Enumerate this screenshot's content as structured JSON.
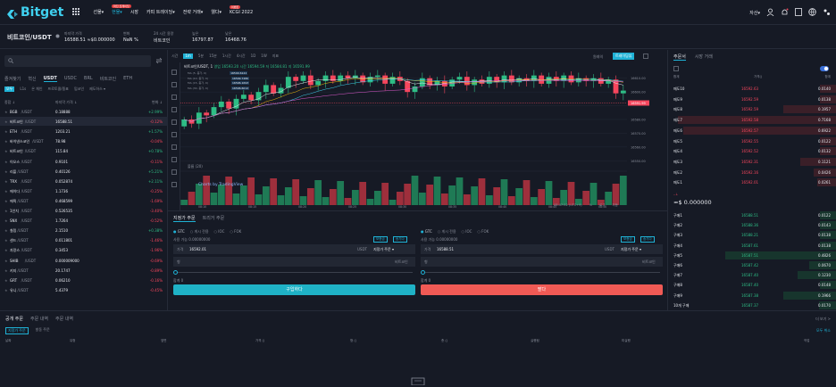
{
  "nav": {
    "logo": "Bitget",
    "items": [
      {
        "label": "선물",
        "caret": "▾"
      },
      {
        "label": "현물",
        "caret": "▾",
        "badge": "마진 트레이딩"
      },
      {
        "label": "시장"
      },
      {
        "label": "카피 트레이딩",
        "caret": "▾"
      },
      {
        "label": "전략 거래",
        "caret": "▾"
      },
      {
        "label": "웰다",
        "caret": "▾"
      },
      {
        "label": "KCGI 2022",
        "badge": "이벤트"
      }
    ],
    "assets_label": "자산",
    "assets_caret": "▾"
  },
  "ticker": {
    "pair": "비트코인/USDT",
    "price_label": "마지막 가격",
    "price": "16588.51 ≈$0.000000",
    "change_label": "변화",
    "change": "NaN %",
    "high_label": "24 시간 용량",
    "high": "비트코인",
    "low_label": "높은",
    "low": "16797.87",
    "vol_label": "낮은",
    "vol": "16468.76"
  },
  "left": {
    "search_placeholder": "",
    "tabs": [
      "즐겨찾기",
      "혁신",
      "USDT",
      "USDC",
      "BRL",
      "비트코인",
      "ETH"
    ],
    "subtabs": [
      "모두",
      "L1s",
      "온 체인",
      "프로토콜/중표",
      "밈코인",
      "제도하스 ▾"
    ],
    "col_pair": "종합 ↓",
    "col_price": "마지막 가격 ↓",
    "col_change": "변화 ↓",
    "rows": [
      {
        "base": "BGB",
        "quote": "/USDT",
        "price": "0.18888",
        "change": "+2.99%",
        "up": true
      },
      {
        "base": "비트코인",
        "quote": "/USDT",
        "price": "16588.51",
        "change": "-0.12%",
        "up": false
      },
      {
        "base": "ETH",
        "quote": "/USDT",
        "price": "1203.21",
        "change": "+1.57%",
        "up": true
      },
      {
        "base": "바이낸스코인",
        "quote": "/USDT",
        "price": "78.98",
        "change": "-0.04%",
        "up": false
      },
      {
        "base": "비트코인",
        "quote": "/USDT",
        "price": "115.84",
        "change": "+0.78%",
        "up": true
      },
      {
        "base": "이오스",
        "quote": "/USDT",
        "price": "0.9101",
        "change": "-0.11%",
        "up": false
      },
      {
        "base": "리플",
        "quote": "/USDT",
        "price": "0.40126",
        "change": "+5.21%",
        "up": true
      },
      {
        "base": "TRX",
        "quote": "/USDT",
        "price": "0.052874",
        "change": "+2.11%",
        "up": true
      },
      {
        "base": "에이다",
        "quote": "/USDT",
        "price": "1.1736",
        "change": "-0.25%",
        "up": false
      },
      {
        "base": "에픽",
        "quote": "/USDT",
        "price": "0.468599",
        "change": "-1.69%",
        "up": false
      },
      {
        "base": "1인치",
        "quote": "/USDT",
        "price": "0.526535",
        "change": "-3.40%",
        "up": false
      },
      {
        "base": "SNX",
        "quote": "/USDT",
        "price": "1.7264",
        "change": "-0.52%",
        "up": false
      },
      {
        "base": "칠링",
        "quote": "/USDT",
        "price": "2.1510",
        "change": "+0.38%",
        "up": true
      },
      {
        "base": "샌드",
        "quote": "/USDT",
        "price": "0.011801",
        "change": "-1.46%",
        "up": false
      },
      {
        "base": "자랑스",
        "quote": "/USDT",
        "price": "0.3453",
        "change": "-1.96%",
        "up": false
      },
      {
        "base": "SHIB",
        "quote": "/USDT",
        "price": "0.000009000",
        "change": "-0.69%",
        "up": false
      },
      {
        "base": "키지",
        "quote": "/USDT",
        "price": "20.1747",
        "change": "-0.89%",
        "up": false
      },
      {
        "base": "GRT",
        "quote": "/USDT",
        "price": "0.06210",
        "change": "-0.16%",
        "up": false
      },
      {
        "base": "유니",
        "quote": "/USDT",
        "price": "5.4379",
        "change": "-0.45%",
        "up": false
      }
    ]
  },
  "chart": {
    "toolbar": [
      "시간",
      "1m",
      "5분",
      "15분",
      "1시간",
      "4시간",
      "1D",
      "1W",
      "지표"
    ],
    "right_tools": [
      "원래의",
      "트레이딩뷰"
    ],
    "title": "비트코인/USDT, 1",
    "open": "영업 16593.20",
    "high": "시간 16594.59",
    "low": "저 16584.81",
    "close": "지 16591.99",
    "ma": [
      {
        "label": "MA (5, 종가, 0)",
        "value": "16590.6122"
      },
      {
        "label": "MA (10, 종가, 0)",
        "value": "16599.7480"
      },
      {
        "label": "MA (15, 종가, 0)",
        "value": "16596.1693"
      },
      {
        "label": "MA (30, 종가, 0)",
        "value": "16596.6012"
      }
    ],
    "volume_label": "볼륨 (20)",
    "watermark": "Charts by TradingView",
    "price_ticks": [
      "16610.00",
      "16600.00",
      "16591.99",
      "16580.00",
      "16570.00",
      "16560.00",
      "16550.00"
    ],
    "current_price": "16591.99",
    "time_ticks": [
      "08:10",
      "08:15",
      "08:20",
      "08:25",
      "08:30",
      "08:35",
      "08:40",
      "08:45",
      "08:50"
    ],
    "footer": [
      "08:47:52 (UTC+9)",
      "%",
      "로그",
      "자동"
    ]
  },
  "order": {
    "tabs": [
      "지정가 주문",
      "트리거 주문"
    ],
    "buy": {
      "opts": [
        "GTC",
        "게시 전용",
        "IOC",
        "FOK"
      ],
      "avail_label": "사용 가능 0.00000000",
      "buttons": [
        "보증금",
        "송기다"
      ],
      "price_label": "가격",
      "price": "16592.01",
      "unit": "USDT",
      "type": "지정가 주문 ▾",
      "qty_label": "형",
      "qty_unit": "비트코인",
      "total": "합계 0",
      "submit": "구입하다"
    },
    "sell": {
      "opts": [
        "GTC",
        "게시 전용",
        "IOC",
        "FOK"
      ],
      "avail_label": "사용 가능 0.00000000",
      "buttons": [
        "보증금",
        "송기다"
      ],
      "price_label": "가격",
      "price": "16588.51",
      "unit": "USDT",
      "type": "지정가 주문 ▾",
      "qty_label": "형",
      "qty_unit": "비트코인",
      "total": "합계 0",
      "submit": "팔다"
    }
  },
  "orderbook": {
    "tabs": [
      "주문서",
      "시장 거래"
    ],
    "col_price": "가격()",
    "col_qty": "합계",
    "col_total": "합계",
    "asks": [
      {
        "label": "매도10",
        "price": "16592.63",
        "qty": "0.0140"
      },
      {
        "label": "매도9",
        "price": "16592.59",
        "qty": "0.0138"
      },
      {
        "label": "매도8",
        "price": "16592.59",
        "qty": "0.1957"
      },
      {
        "label": "매도7",
        "price": "16592.58",
        "qty": "0.7168"
      },
      {
        "label": "매도6",
        "price": "16592.57",
        "qty": "0.6922"
      },
      {
        "label": "매도5",
        "price": "16592.55",
        "qty": "0.0122"
      },
      {
        "label": "매도4",
        "price": "16592.52",
        "qty": "0.0132"
      },
      {
        "label": "매도3",
        "price": "16592.31",
        "qty": "0.1121"
      },
      {
        "label": "매도2",
        "price": "16592.16",
        "qty": "0.0426"
      },
      {
        "label": "매도1",
        "price": "16592.01",
        "qty": "0.0261"
      }
    ],
    "mid": "≈$ 0.000000",
    "mid_arrow": "--↓",
    "bids": [
      {
        "label": "구매1",
        "price": "16588.51",
        "qty": "0.0122"
      },
      {
        "label": "구매2",
        "price": "16588.36",
        "qty": "0.0143"
      },
      {
        "label": "구매3",
        "price": "16588.21",
        "qty": "0.0138"
      },
      {
        "label": "구매4",
        "price": "16587.61",
        "qty": "0.0138"
      },
      {
        "label": "구매5",
        "price": "16587.51",
        "qty": "0.4826"
      },
      {
        "label": "구매6",
        "price": "16587.42",
        "qty": "0.0670"
      },
      {
        "label": "구매7",
        "price": "16587.40",
        "qty": "0.1230"
      },
      {
        "label": "구매8",
        "price": "16587.40",
        "qty": "0.0148"
      },
      {
        "label": "구매9",
        "price": "16587.38",
        "qty": "0.1966"
      },
      {
        "label": "10개 구매",
        "price": "16587.37",
        "qty": "0.0170"
      }
    ]
  },
  "bottom": {
    "tabs": [
      "공개 주문",
      "주문 내역",
      "주문 내역"
    ],
    "subtabs": [
      "지정가 주문",
      "발동 주문"
    ],
    "right_link": "더 보기 >",
    "cancel_all": "모두 취소",
    "cols": [
      "날짜",
      "유형",
      "옆면",
      "가격 ()",
      "형 ()",
      "총 ()",
      "실행됨",
      "미실행",
      "작업"
    ]
  },
  "colors": {
    "bg": "#161a25",
    "up": "#2ebd85",
    "down": "#f6465d",
    "accent": "#1fb2d6",
    "buy": "#1fb2c6",
    "sell": "#f05a55"
  }
}
